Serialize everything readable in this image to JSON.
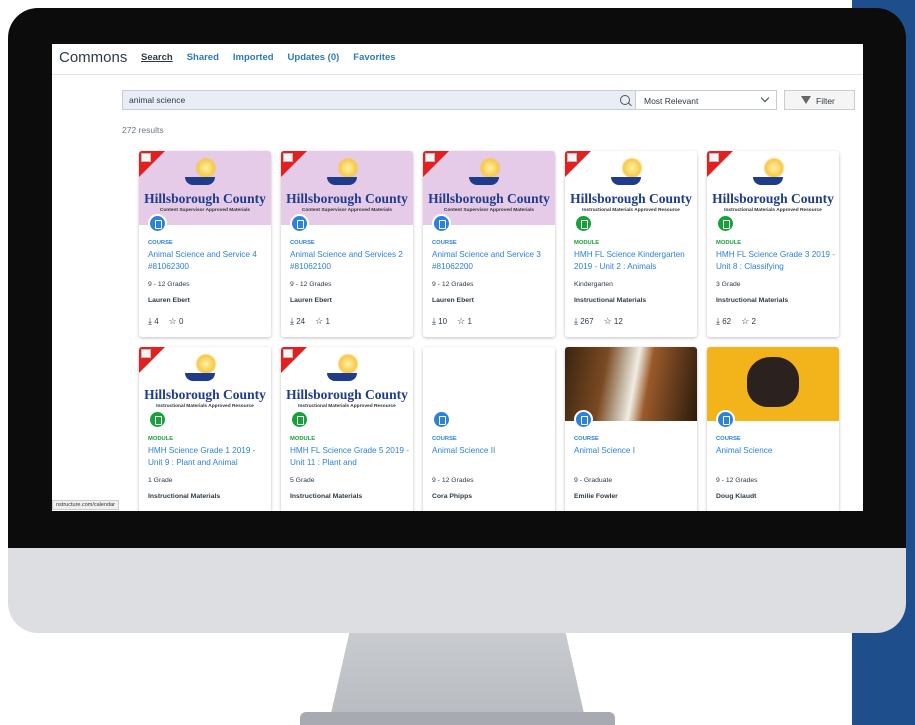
{
  "app": {
    "brand": "Commons",
    "nav": [
      {
        "label": "Search",
        "active": true
      },
      {
        "label": "Shared",
        "active": false
      },
      {
        "label": "Imported",
        "active": false
      },
      {
        "label": "Updates (0)",
        "active": false
      },
      {
        "label": "Favorites",
        "active": false
      }
    ]
  },
  "search": {
    "value": "animal science",
    "icon": "search-icon"
  },
  "sort": {
    "value": "Most Relevant",
    "icon": "chevron-down-icon"
  },
  "filter": {
    "label": "Filter",
    "icon": "filter-icon"
  },
  "results": {
    "count_text": "272 results"
  },
  "colors": {
    "link": "#2b82d9",
    "module": "#18a03a",
    "accent_stripe": "#1f4e8c"
  },
  "status_url": "nstructure.com/calendar",
  "cards": [
    {
      "thumb": "hillsborough-purple",
      "hc_title": "Hillsborough County",
      "hc_sub": "Content Supervisor Approved Materials",
      "type": "COURSE",
      "title": "Animal Science and Service 4 #81062300",
      "grade": "9 - 12 Grades",
      "author": "Lauren Ebert",
      "downloads": "4",
      "favorites": "0"
    },
    {
      "thumb": "hillsborough-purple",
      "hc_title": "Hillsborough County",
      "hc_sub": "Content Supervisor Approved Materials",
      "type": "COURSE",
      "title": "Animal Science and Services 2 #81062100",
      "grade": "9 - 12 Grades",
      "author": "Lauren Ebert",
      "downloads": "24",
      "favorites": "1"
    },
    {
      "thumb": "hillsborough-purple",
      "hc_title": "Hillsborough County",
      "hc_sub": "Content Supervisor Approved Materials",
      "type": "COURSE",
      "title": "Animal Science and Service 3 #81062200",
      "grade": "9 - 12 Grades",
      "author": "Lauren Ebert",
      "downloads": "10",
      "favorites": "1"
    },
    {
      "thumb": "hillsborough-white",
      "hc_title": "Hillsborough County",
      "hc_sub": "Instructional Materials Approved Resource",
      "type": "MODULE",
      "title": "HMH FL Science Kindergarten 2019 - Unit 2 : Animals",
      "grade": "Kindergarten",
      "author": "Instructional Materials",
      "downloads": "267",
      "favorites": "12"
    },
    {
      "thumb": "hillsborough-white",
      "hc_title": "Hillsborough County",
      "hc_sub": "Instructional Materials Approved Resource",
      "type": "MODULE",
      "title": "HMH FL Science Grade 3 2019 - Unit 8 : Classifying",
      "grade": "3 Grade",
      "author": "Instructional Materials",
      "downloads": "62",
      "favorites": "2"
    },
    {
      "thumb": "hillsborough-white",
      "hc_title": "Hillsborough County",
      "hc_sub": "Instructional Materials Approved Resource",
      "type": "MODULE",
      "title": "HMH Science Grade 1 2019 - Unit 9 : Plant and Animal",
      "grade": "1 Grade",
      "author": "Instructional Materials",
      "downloads": "",
      "favorites": ""
    },
    {
      "thumb": "hillsborough-white",
      "hc_title": "Hillsborough County",
      "hc_sub": "Instructional Materials Approved Resource",
      "type": "MODULE",
      "title": "HMH FL Science Grade 5 2019 - Unit 11 : Plant and",
      "grade": "5 Grade",
      "author": "Instructional Materials",
      "downloads": "",
      "favorites": ""
    },
    {
      "thumb": "blank",
      "hc_title": "",
      "hc_sub": "",
      "type": "COURSE",
      "title": "Animal Science II",
      "grade": "9 - 12 Grades",
      "author": "Cora Phipps",
      "downloads": "",
      "favorites": ""
    },
    {
      "thumb": "horse",
      "hc_title": "",
      "hc_sub": "",
      "type": "COURSE",
      "title": "Animal Science I",
      "grade": "9 - Graduate",
      "author": "Emilie Fowler",
      "downloads": "",
      "favorites": ""
    },
    {
      "thumb": "pug",
      "hc_title": "",
      "hc_sub": "",
      "type": "COURSE",
      "title": "Animal Science",
      "grade": "9 - 12 Grades",
      "author": "Doug Klaudt",
      "downloads": "",
      "favorites": ""
    }
  ]
}
